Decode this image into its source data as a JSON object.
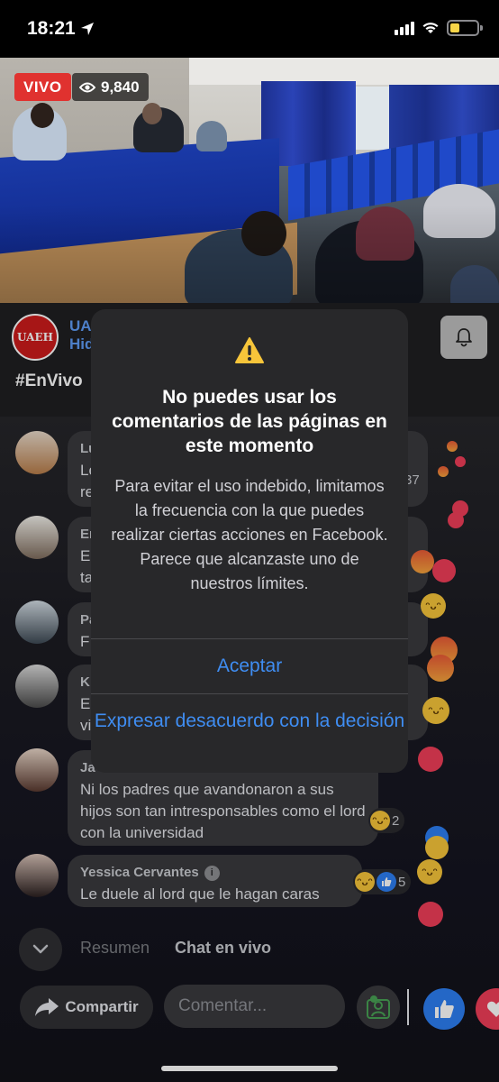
{
  "status_bar": {
    "time": "18:21"
  },
  "live": {
    "badge": "VIVO",
    "viewers": "9,840"
  },
  "page": {
    "avatar_text": "UAEH",
    "name_line1": "UA",
    "name_line2": "Hid",
    "hashtag": "#EnVivo"
  },
  "comments": [
    {
      "name": "Lu",
      "text1": "Le",
      "text2": "re",
      "count": "37"
    },
    {
      "name": "Er",
      "text1": "E",
      "text2": "ta"
    },
    {
      "name": "Pa",
      "text1": "F"
    },
    {
      "name": "K",
      "text1": "E",
      "text2": "vi"
    },
    {
      "name": "Ja",
      "text": "Ni los padres que avandonaron a sus hijos son tan intresponsables como el lord con la universidad",
      "reaction_count": "2"
    },
    {
      "name": "Yessica Cervantes",
      "text": "Le duele al lord que le hagan caras",
      "reaction_count": "5"
    }
  ],
  "bottom": {
    "tab_summary": "Resumen",
    "tab_chat": "Chat en vivo",
    "share_label": "Compartir",
    "comment_placeholder": "Comentar..."
  },
  "modal": {
    "title": "No puedes usar los comentarios de las páginas en este momento",
    "body": "Para evitar el uso indebido, limitamos la frecuencia con la que puedes realizar ciertas acciones en Facebook. Parece que alcanzaste uno de nuestros límites.",
    "accept_label": "Aceptar",
    "disagree_label": "Expresar desacuerdo con la decisión"
  },
  "colors": {
    "live_red": "#e0322f",
    "link_blue": "#3f8df2",
    "like_blue": "#2d7ef2",
    "love_red": "#f03e58",
    "warning_yellow": "#f7c53a"
  },
  "icons": [
    "location-arrow-icon",
    "signal-icon",
    "wifi-icon",
    "battery-icon",
    "eye-icon",
    "bell-icon",
    "warning-icon",
    "chevron-down-icon",
    "share-arrow-icon",
    "avatar-switch-icon",
    "like-icon",
    "love-icon"
  ]
}
